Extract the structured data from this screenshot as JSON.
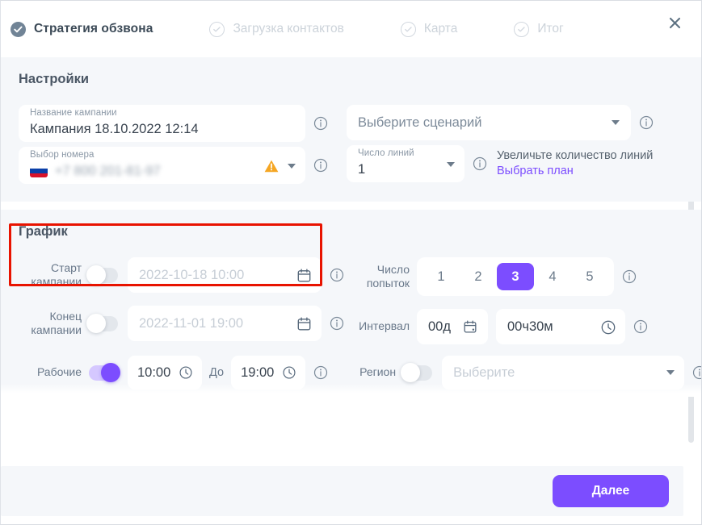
{
  "header": {
    "close_label": "×",
    "close_icon": "close-icon",
    "steps": [
      {
        "label": "Стратегия обзвона",
        "state": "active",
        "icon": "check-circle-filled-icon"
      },
      {
        "label": "Загрузка контактов",
        "state": "inactive",
        "icon": "check-circle-outline-icon"
      },
      {
        "label": "Карта",
        "state": "inactive",
        "icon": "check-circle-outline-icon"
      },
      {
        "label": "Итог",
        "state": "inactive",
        "icon": "check-circle-outline-icon"
      }
    ]
  },
  "settings": {
    "title": "Настройки",
    "campaign_name": {
      "label": "Название кампании",
      "value": "Кампания 18.10.2022 12:14"
    },
    "number_select": {
      "label": "Выбор номера",
      "value": "+7 800 201-81-97",
      "flag": "ru-flag-icon",
      "warning_icon": "warning-triangle-icon",
      "caret_icon": "chevron-down-icon"
    },
    "scenario_select": {
      "placeholder": "Выберите сценарий",
      "caret_icon": "chevron-down-icon"
    },
    "lines_count": {
      "label": "Число линий",
      "value": "1",
      "caret_icon": "chevron-down-icon"
    },
    "upsell": {
      "text": "Увеличьте количество линий",
      "link": "Выбрать план"
    }
  },
  "schedule": {
    "title": "График",
    "start": {
      "label_line1": "Старт",
      "label_line2": "кампании",
      "toggle_state": "off",
      "value": "2022-10-18 10:00",
      "calendar_icon": "calendar-icon"
    },
    "end": {
      "label_line1": "Конец",
      "label_line2": "кампании",
      "toggle_state": "off",
      "value": "2022-11-01 19:00",
      "calendar_icon": "calendar-icon"
    },
    "working_hours": {
      "label": "Рабочие",
      "toggle_state": "on",
      "from_value": "10:00",
      "conjunction": "До",
      "to_value": "19:00",
      "clock_icon": "clock-icon"
    },
    "attempts": {
      "label_line1": "Число",
      "label_line2": "попыток",
      "options": [
        "1",
        "2",
        "3",
        "4",
        "5"
      ],
      "selected": "3"
    },
    "interval": {
      "label": "Интервал",
      "days_value": "00д",
      "time_value": "00ч30м",
      "calendar_icon": "calendar-icon",
      "clock_icon": "clock-icon"
    },
    "region": {
      "label": "Регион",
      "toggle_state": "off",
      "placeholder": "Выберите",
      "caret_icon": "chevron-down-icon"
    }
  },
  "footer": {
    "next_label": "Далее"
  },
  "annotation": {
    "highlight_color": "#e81300"
  },
  "colors": {
    "accent": "#7c4dff",
    "card_bg": "#f5f7fa",
    "warning": "#f5a623",
    "step_active": "#718496"
  }
}
